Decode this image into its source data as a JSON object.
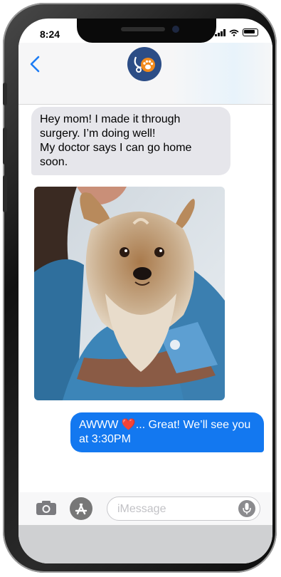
{
  "status_bar": {
    "time": "8:24"
  },
  "header": {
    "back_icon": "chevron-left-icon",
    "avatar_icon": "vet-paw-logo-icon"
  },
  "messages": [
    {
      "from": "received",
      "text": "Hey mom! I made it through surgery. I’m doing well!\nMy doctor says I can go home soon."
    },
    {
      "from": "received",
      "type": "image",
      "subject": "yorkshire-terrier-held-by-vet"
    },
    {
      "from": "sent",
      "text": "AWWW ❤️... Great! We’ll see you at 3:30PM"
    }
  ],
  "composer": {
    "camera_icon": "camera-icon",
    "apps_icon": "app-store-icon",
    "placeholder": "iMessage",
    "mic_icon": "microphone-icon"
  },
  "colors": {
    "sent_bubble": "#1378f0",
    "received_bubble": "#e6e6eb",
    "link_blue": "#1c7cf4",
    "avatar_bg": "#2c4d86",
    "paw_orange": "#f28a1c"
  }
}
